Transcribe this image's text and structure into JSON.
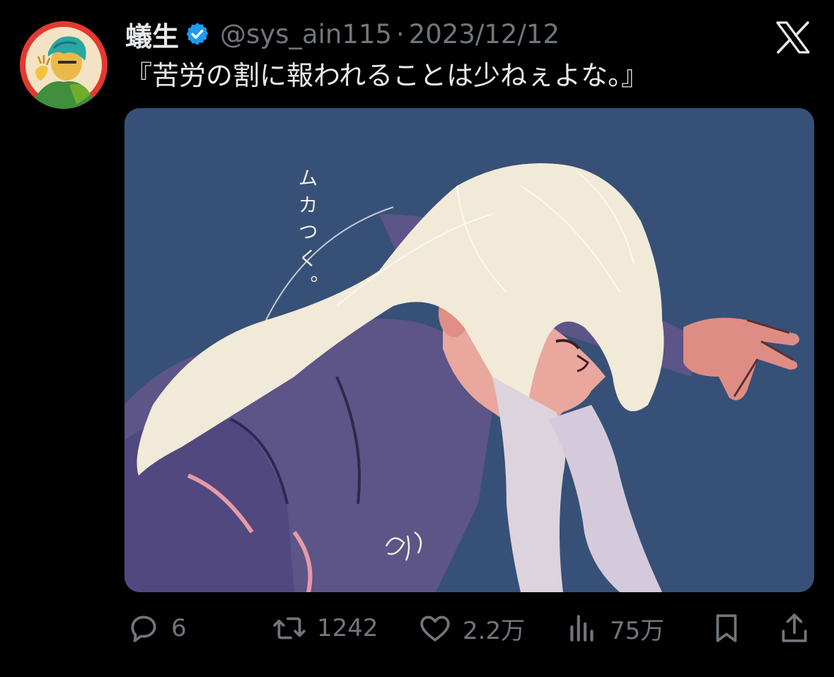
{
  "author": {
    "display_name": "蟻生",
    "handle": "@sys_ain115",
    "separator": "·",
    "date": "2023/12/12",
    "verified": true,
    "avatar": "avatar-illustration"
  },
  "tweet": {
    "text": "『苦労の割に報われることは少ねぇよな。』"
  },
  "media": {
    "caption_text": "ムカつく。",
    "signature": "ゆか"
  },
  "actions": [
    {
      "name": "reply",
      "icon": "reply-icon",
      "count": "6"
    },
    {
      "name": "retweet",
      "icon": "retweet-icon",
      "count": "1242"
    },
    {
      "name": "like",
      "icon": "heart-icon",
      "count": "2.2万"
    },
    {
      "name": "views",
      "icon": "views-icon",
      "count": "75万"
    },
    {
      "name": "bookmark",
      "icon": "bookmark-icon"
    },
    {
      "name": "share",
      "icon": "share-icon"
    }
  ],
  "colors": {
    "background": "#000000",
    "text": "#e7e9ea",
    "muted": "#71767b",
    "verified": "#1d9bf0",
    "media_background": "#375077"
  }
}
